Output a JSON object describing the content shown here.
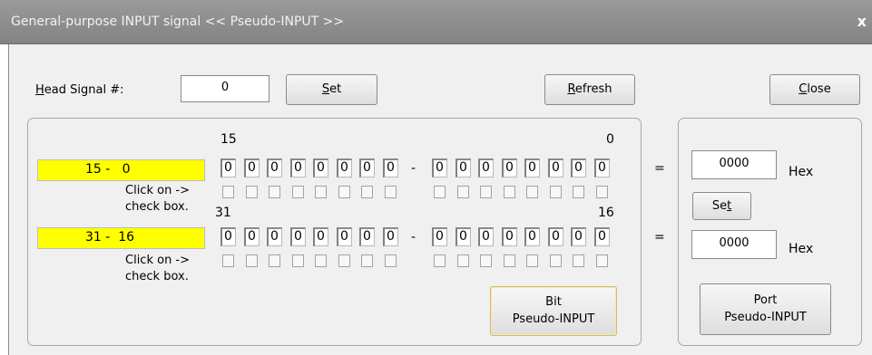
{
  "window": {
    "title": "General-purpose INPUT signal << Pseudo-INPUT >>",
    "close_glyph": "x"
  },
  "head": {
    "label_hotkey": "H",
    "label_rest": "ead Signal #:",
    "value": "0",
    "set_hotkey": "S",
    "set_rest": "et"
  },
  "toolbar": {
    "refresh_hotkey": "R",
    "refresh_rest": "efresh",
    "close_hotkey": "C",
    "close_rest": "lose"
  },
  "rows": [
    {
      "range_label": "15 -   0",
      "bit_hi_label": "15",
      "bit_lo_label": "0",
      "bits_left": [
        "0",
        "0",
        "0",
        "0",
        "0",
        "0",
        "0",
        "0"
      ],
      "bits_right": [
        "0",
        "0",
        "0",
        "0",
        "0",
        "0",
        "0",
        "0"
      ],
      "dash": "-",
      "click_hint_1": "Click on ->",
      "click_hint_2": "check box.",
      "equals": "=",
      "hex_value": "0000",
      "hex_unit": "Hex"
    },
    {
      "range_label": "31 -  16",
      "bit_hi_label": "31",
      "bit_lo_label": "16",
      "bits_left": [
        "0",
        "0",
        "0",
        "0",
        "0",
        "0",
        "0",
        "0"
      ],
      "bits_right": [
        "0",
        "0",
        "0",
        "0",
        "0",
        "0",
        "0",
        "0"
      ],
      "dash": "-",
      "click_hint_1": "Click on ->",
      "click_hint_2": "check box.",
      "equals": "=",
      "hex_value": "0000",
      "hex_unit": "Hex"
    }
  ],
  "port_panel": {
    "set_prefix": "Se",
    "set_hotkey": "t",
    "port_button_line1": "Port",
    "port_button_line2": "Pseudo-INPUT"
  },
  "bit_button": {
    "line1": "Bit",
    "line2": "Pseudo-INPUT"
  }
}
